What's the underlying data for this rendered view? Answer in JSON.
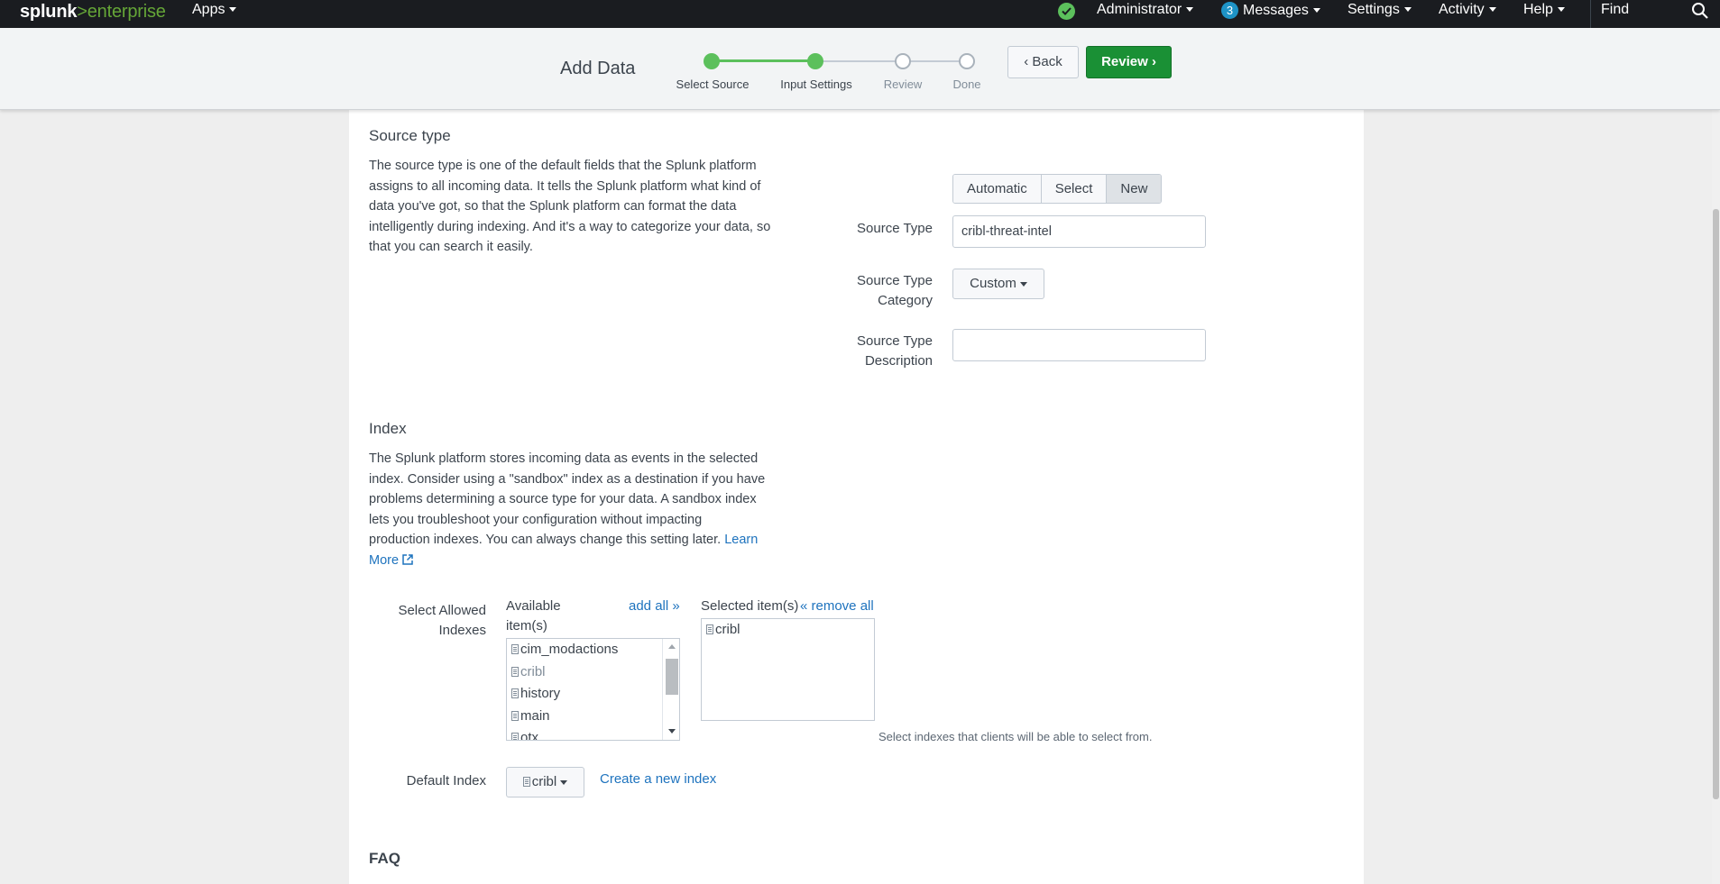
{
  "nav": {
    "logo_splunk": "splunk",
    "logo_gt": ">",
    "logo_product": "enterprise",
    "apps": "Apps",
    "administrator": "Administrator",
    "messages_count": "3",
    "messages": "Messages",
    "settings": "Settings",
    "activity": "Activity",
    "help": "Help",
    "find": "Find"
  },
  "wizard": {
    "title": "Add Data",
    "steps": [
      {
        "label": "Select Source",
        "state": "done"
      },
      {
        "label": "Input Settings",
        "state": "current"
      },
      {
        "label": "Review",
        "state": "todo"
      },
      {
        "label": "Done",
        "state": "todo"
      }
    ],
    "back_label": "Back",
    "review_label": "Review"
  },
  "source_type": {
    "heading": "Source type",
    "description": "The source type is one of the default fields that the Splunk platform assigns to all incoming data. It tells the Splunk platform what kind of data you've got, so that the Splunk platform can format the data intelligently during indexing. And it's a way to categorize your data, so that you can search it easily.",
    "modes": [
      "Automatic",
      "Select",
      "New"
    ],
    "selected_mode": "New",
    "source_type_label": "Source Type",
    "source_type_value": "cribl-threat-intel",
    "category_label_1": "Source Type",
    "category_label_2": "Category",
    "category_value": "Custom",
    "description_label_1": "Source Type",
    "description_label_2": "Description",
    "description_value": ""
  },
  "index": {
    "heading": "Index",
    "description": "The Splunk platform stores incoming data as events in the selected index. Consider using a \"sandbox\" index as a destination if you have problems determining a source type for your data. A sandbox index lets you troubleshoot your configuration without impacting production indexes. You can always change this setting later.",
    "learn_more": "Learn More",
    "allowed_label_1": "Select Allowed",
    "allowed_label_2": "Indexes",
    "available_label_1": "Available",
    "available_label_2": "item(s)",
    "add_all": "add all »",
    "selected_label": "Selected item(s)",
    "remove_all": "« remove all",
    "available_items": [
      "cim_modactions",
      "cribl",
      "history",
      "main",
      "otx"
    ],
    "selected_items": [
      "cribl"
    ],
    "hint": "Select indexes that clients will be able to select from.",
    "default_label": "Default Index",
    "default_value": "cribl",
    "create_index": "Create a new index"
  },
  "faq": {
    "heading": "FAQ"
  },
  "colors": {
    "accent_green": "#5cc05c",
    "primary_button": "#1a9035",
    "link_blue": "#1e73be",
    "nav_bg": "#1a1c20"
  }
}
